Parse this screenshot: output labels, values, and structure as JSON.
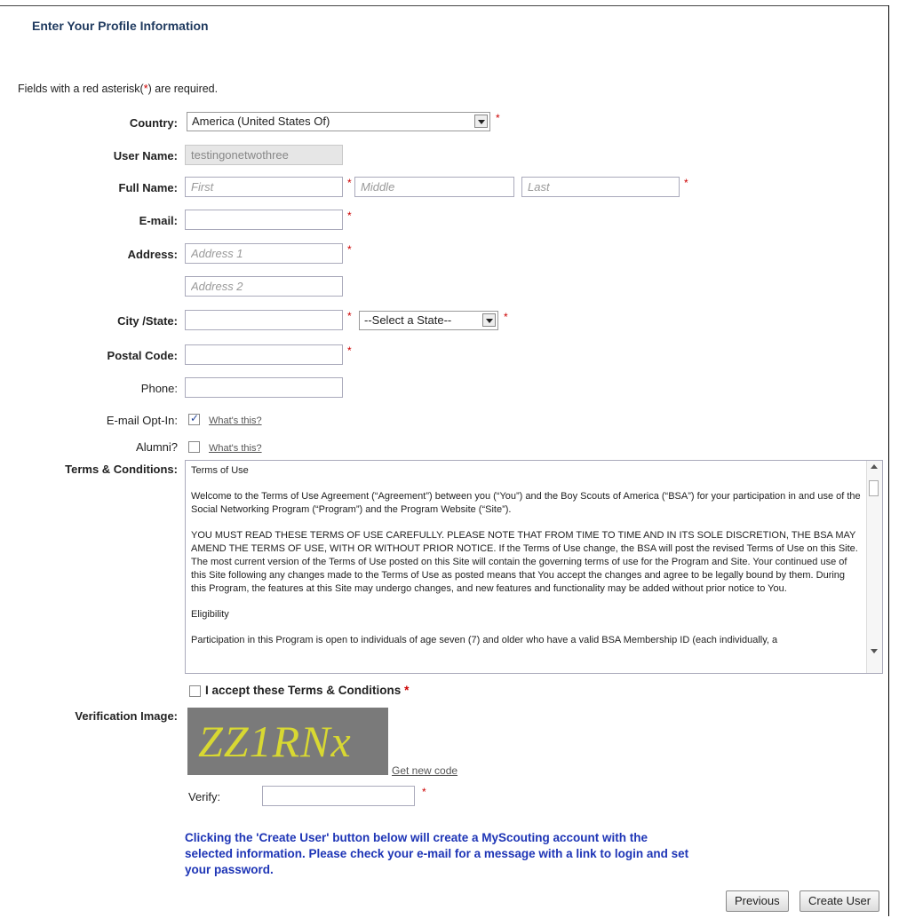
{
  "header": "Enter Your Profile Information",
  "required_note": {
    "before": "Fields with a red asterisk(",
    "star": "*",
    "after": ") are required."
  },
  "form": {
    "country": {
      "label": "Country:",
      "value": "America (United States Of)"
    },
    "username": {
      "label": "User Name:",
      "value": "testingonetwothree"
    },
    "fullname": {
      "label": "Full Name:",
      "first": "First",
      "middle": "Middle",
      "last": "Last"
    },
    "email": {
      "label": "E-mail:"
    },
    "address": {
      "label": "Address:",
      "line1": "Address 1",
      "line2": "Address 2"
    },
    "city": {
      "label": "City /State:",
      "state_value": "--Select a State--"
    },
    "postal": {
      "label": "Postal Code:"
    },
    "phone": {
      "label": "Phone:"
    },
    "optin": {
      "label": "E-mail Opt-In:",
      "link": "What's this?",
      "checked": true
    },
    "alumni": {
      "label": "Alumni?",
      "link": "What's this?",
      "checked": false
    },
    "terms": {
      "label": "Terms & Conditions:",
      "paragraphs": [
        "Terms of Use",
        "Welcome to the Terms of Use Agreement (“Agreement”) between you (“You”) and the Boy Scouts of America (“BSA”) for your participation in and use of the Social Networking Program (“Program”) and the Program Website (“Site”).",
        "YOU MUST READ THESE TERMS OF USE CAREFULLY.  PLEASE NOTE THAT FROM TIME TO TIME AND IN ITS SOLE DISCRETION, THE BSA MAY AMEND THE TERMS OF USE, WITH OR WITHOUT PRIOR NOTICE.  If the Terms of Use change, the BSA will post the revised Terms of Use on this Site.  The most current version of the Terms of Use posted on this Site will contain the governing terms of use for the Program and Site.  Your continued use of this Site following any changes made to the Terms of Use as posted means that You accept the changes and agree to be legally bound by them.  During this Program, the features at this Site may undergo changes, and new features and functionality may be added without prior notice to You.",
        "Eligibility",
        "Participation in this Program is open to individuals of age seven (7) and older who have a valid BSA Membership ID (each individually, a"
      ],
      "accept": "I accept these Terms & Conditions"
    },
    "verification": {
      "label": "Verification Image:",
      "code": "ZZ1RNx",
      "new_code": "Get new code",
      "verify_label": "Verify:"
    },
    "star": "*"
  },
  "message": "Clicking the 'Create User' button below will create a MyScouting account with the selected information. Please check your e-mail for a message with a link to login and set your password.",
  "buttons": {
    "previous": "Previous",
    "create": "Create User"
  }
}
